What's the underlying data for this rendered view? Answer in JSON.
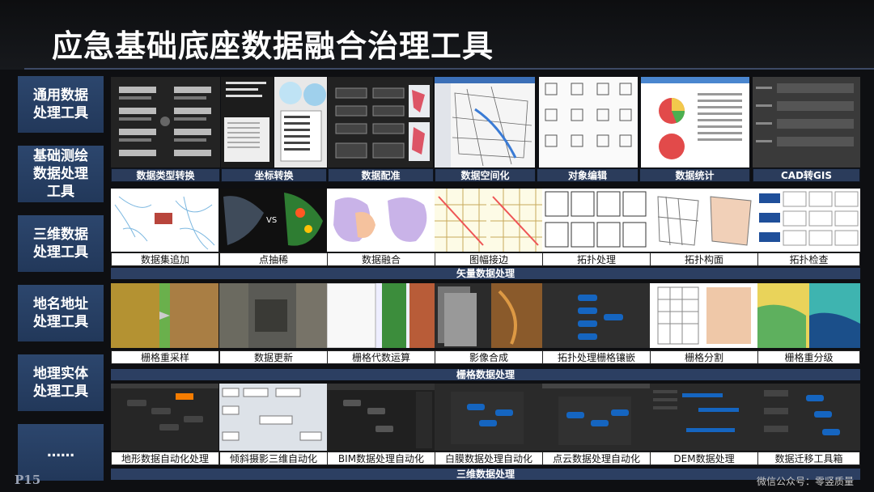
{
  "title": "应急基础底座数据融合治理工具",
  "page_number": "P15",
  "watermark": "微信公众号：零竖质量",
  "sidebar": [
    {
      "label": "通用数据\n处理工具"
    },
    {
      "label": "基础测绘\n数据处理\n工具"
    },
    {
      "label": "三维数据\n处理工具"
    },
    {
      "label": "地名地址\n处理工具"
    },
    {
      "label": "地理实体\n处理工具"
    },
    {
      "label": "……"
    }
  ],
  "rows": {
    "row1": {
      "labels": [
        "数据类型转换",
        "坐标转换",
        "数据配准",
        "数据空间化",
        "对象编辑",
        "数据统计",
        "CAD转GIS"
      ]
    },
    "row2": {
      "labels": [
        "数据集追加",
        "点抽稀",
        "数据融合",
        "图幅接边",
        "拓扑处理",
        "拓扑构面",
        "拓扑检查"
      ],
      "group": "矢量数据处理"
    },
    "row3": {
      "labels": [
        "栅格重采样",
        "数据更新",
        "栅格代数运算",
        "影像合成",
        "拓扑处理栅格镶嵌",
        "栅格分割",
        "栅格重分级"
      ],
      "group": "栅格数据处理"
    },
    "row4": {
      "labels": [
        "地形数据自动化处理",
        "倾斜摄影三维自动化",
        "BIM数据处理自动化",
        "白膜数据处理自动化",
        "点云数据处理自动化",
        "DEM数据处理",
        "数据迁移工具箱"
      ],
      "group": "三维数据处理"
    }
  },
  "thumb_texts": {
    "vs": "VS"
  },
  "colors": {
    "sidebar_bg": "#2c466d",
    "label_dark_bg": "#2b3c5b",
    "group_bg": "#2c3f62",
    "background": "#0e0f12"
  }
}
